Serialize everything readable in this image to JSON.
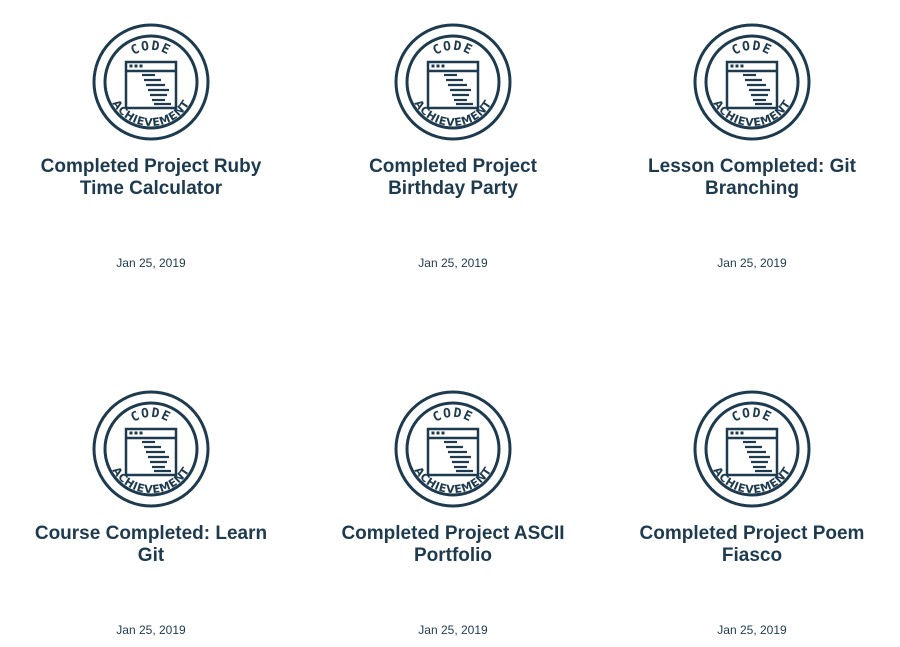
{
  "badge": {
    "top_text": "CODE",
    "bottom_text": "ACHIEVEMENT",
    "color": "#1d3a4e"
  },
  "achievements": [
    {
      "title": "Completed Project Ruby Time Calculator",
      "date": "Jan 25, 2019",
      "icon": "code-achievement-badge-icon"
    },
    {
      "title": "Completed Project Birthday Party",
      "date": "Jan 25, 2019",
      "icon": "code-achievement-badge-icon"
    },
    {
      "title": "Lesson Completed: Git Branching",
      "date": "Jan 25, 2019",
      "icon": "code-achievement-badge-icon"
    },
    {
      "title": "Course Completed: Learn Git",
      "date": "Jan 25, 2019",
      "icon": "code-achievement-badge-icon"
    },
    {
      "title": "Completed Project ASCII Portfolio",
      "date": "Jan 25, 2019",
      "icon": "code-achievement-badge-icon"
    },
    {
      "title": "Completed Project Poem Fiasco",
      "date": "Jan 25, 2019",
      "icon": "code-achievement-badge-icon"
    }
  ]
}
